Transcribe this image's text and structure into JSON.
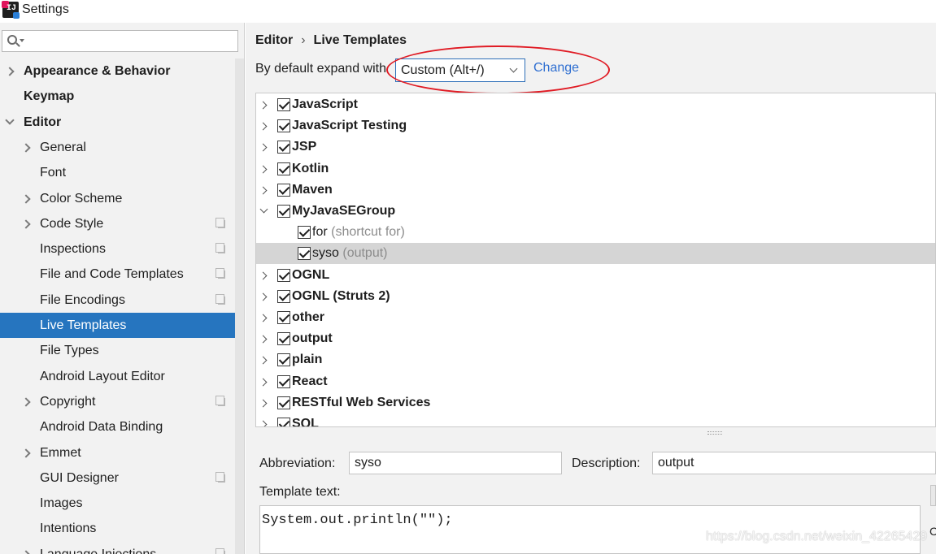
{
  "window": {
    "title": "Settings"
  },
  "search": {
    "placeholder": ""
  },
  "sidebar": {
    "items": [
      {
        "label": "Appearance & Behavior",
        "level": 0,
        "bold": true,
        "chevron": "right",
        "copy": false,
        "selected": false
      },
      {
        "label": "Keymap",
        "level": 0,
        "bold": true,
        "chevron": "none",
        "copy": false,
        "selected": false
      },
      {
        "label": "Editor",
        "level": 0,
        "bold": true,
        "chevron": "down",
        "copy": false,
        "selected": false
      },
      {
        "label": "General",
        "level": 1,
        "bold": false,
        "chevron": "right",
        "copy": false,
        "selected": false
      },
      {
        "label": "Font",
        "level": 1,
        "bold": false,
        "chevron": "none",
        "copy": false,
        "selected": false
      },
      {
        "label": "Color Scheme",
        "level": 1,
        "bold": false,
        "chevron": "right",
        "copy": false,
        "selected": false
      },
      {
        "label": "Code Style",
        "level": 1,
        "bold": false,
        "chevron": "right",
        "copy": true,
        "selected": false
      },
      {
        "label": "Inspections",
        "level": 1,
        "bold": false,
        "chevron": "none",
        "copy": true,
        "selected": false
      },
      {
        "label": "File and Code Templates",
        "level": 1,
        "bold": false,
        "chevron": "none",
        "copy": true,
        "selected": false
      },
      {
        "label": "File Encodings",
        "level": 1,
        "bold": false,
        "chevron": "none",
        "copy": true,
        "selected": false
      },
      {
        "label": "Live Templates",
        "level": 1,
        "bold": false,
        "chevron": "none",
        "copy": false,
        "selected": true
      },
      {
        "label": "File Types",
        "level": 1,
        "bold": false,
        "chevron": "none",
        "copy": false,
        "selected": false
      },
      {
        "label": "Android Layout Editor",
        "level": 1,
        "bold": false,
        "chevron": "none",
        "copy": false,
        "selected": false
      },
      {
        "label": "Copyright",
        "level": 1,
        "bold": false,
        "chevron": "right",
        "copy": true,
        "selected": false
      },
      {
        "label": "Android Data Binding",
        "level": 1,
        "bold": false,
        "chevron": "none",
        "copy": false,
        "selected": false
      },
      {
        "label": "Emmet",
        "level": 1,
        "bold": false,
        "chevron": "right",
        "copy": false,
        "selected": false
      },
      {
        "label": "GUI Designer",
        "level": 1,
        "bold": false,
        "chevron": "none",
        "copy": true,
        "selected": false
      },
      {
        "label": "Images",
        "level": 1,
        "bold": false,
        "chevron": "none",
        "copy": false,
        "selected": false
      },
      {
        "label": "Intentions",
        "level": 1,
        "bold": false,
        "chevron": "none",
        "copy": false,
        "selected": false
      },
      {
        "label": "Language Injections",
        "level": 1,
        "bold": false,
        "chevron": "right",
        "copy": true,
        "selected": false
      }
    ]
  },
  "main": {
    "breadcrumb": {
      "parent": "Editor",
      "separator": "›",
      "current": "Live Templates"
    },
    "expand": {
      "label": "By default expand with",
      "value": "Custom (Alt+/)",
      "change_link": "Change"
    },
    "tree": [
      {
        "label": "JavaScript",
        "desc": "",
        "group": true,
        "expanded": false,
        "checked": true,
        "selected": false
      },
      {
        "label": "JavaScript Testing",
        "desc": "",
        "group": true,
        "expanded": false,
        "checked": true,
        "selected": false
      },
      {
        "label": "JSP",
        "desc": "",
        "group": true,
        "expanded": false,
        "checked": true,
        "selected": false
      },
      {
        "label": "Kotlin",
        "desc": "",
        "group": true,
        "expanded": false,
        "checked": true,
        "selected": false
      },
      {
        "label": "Maven",
        "desc": "",
        "group": true,
        "expanded": false,
        "checked": true,
        "selected": false
      },
      {
        "label": "MyJavaSEGroup",
        "desc": "",
        "group": true,
        "expanded": true,
        "checked": true,
        "selected": false
      },
      {
        "label": "for",
        "desc": "(shortcut for)",
        "group": false,
        "expanded": false,
        "checked": true,
        "selected": false
      },
      {
        "label": "syso",
        "desc": "(output)",
        "group": false,
        "expanded": false,
        "checked": true,
        "selected": true
      },
      {
        "label": "OGNL",
        "desc": "",
        "group": true,
        "expanded": false,
        "checked": true,
        "selected": false
      },
      {
        "label": "OGNL (Struts 2)",
        "desc": "",
        "group": true,
        "expanded": false,
        "checked": true,
        "selected": false
      },
      {
        "label": "other",
        "desc": "",
        "group": true,
        "expanded": false,
        "checked": true,
        "selected": false
      },
      {
        "label": "output",
        "desc": "",
        "group": true,
        "expanded": false,
        "checked": true,
        "selected": false
      },
      {
        "label": "plain",
        "desc": "",
        "group": true,
        "expanded": false,
        "checked": true,
        "selected": false
      },
      {
        "label": "React",
        "desc": "",
        "group": true,
        "expanded": false,
        "checked": true,
        "selected": false
      },
      {
        "label": "RESTful Web Services",
        "desc": "",
        "group": true,
        "expanded": false,
        "checked": true,
        "selected": false
      },
      {
        "label": "SQL",
        "desc": "",
        "group": true,
        "expanded": false,
        "checked": true,
        "selected": false
      }
    ],
    "abbreviation": {
      "label": "Abbreviation:",
      "value": "syso"
    },
    "description": {
      "label": "Description:",
      "value": "output"
    },
    "template_text": {
      "label": "Template text:",
      "value": "System.out.println(\"\");"
    },
    "right_edge_text": "C"
  },
  "watermark": "https://blog.csdn.net/weixin_42265429",
  "colors": {
    "accent": "#2675bf",
    "link": "#2f6fd1",
    "annotation": "#e01b24",
    "selected_row": "#d5d5d5"
  }
}
